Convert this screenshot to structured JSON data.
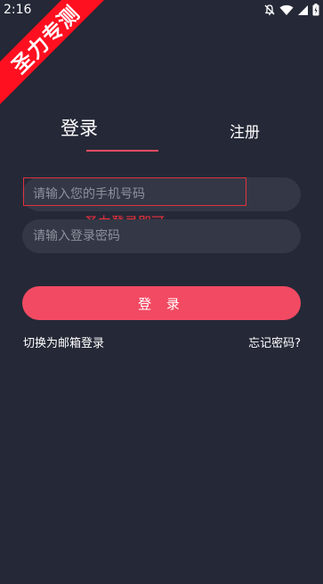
{
  "status_bar": {
    "time": "2:16",
    "icons": [
      "notification-off-icon",
      "wifi-icon",
      "signal-icon",
      "battery-charging-icon"
    ]
  },
  "watermark": {
    "text": "圣力专测",
    "color": "#ff1020"
  },
  "tabs": [
    {
      "label": "登录",
      "active": true
    },
    {
      "label": "注册",
      "active": false
    }
  ],
  "form": {
    "phone_placeholder": "请输入您的手机号码",
    "phone_value": "",
    "password_placeholder": "请输入登录密码",
    "password_value": "",
    "submit_label": "登 录"
  },
  "annotation": {
    "text": "圣力登录即可",
    "color": "#f0303c"
  },
  "links": {
    "email_login": "切换为邮箱登录",
    "forgot_password": "忘记密码?"
  },
  "colors": {
    "background": "#252937",
    "accent": "#f24a63",
    "input_bg": "#343846"
  }
}
